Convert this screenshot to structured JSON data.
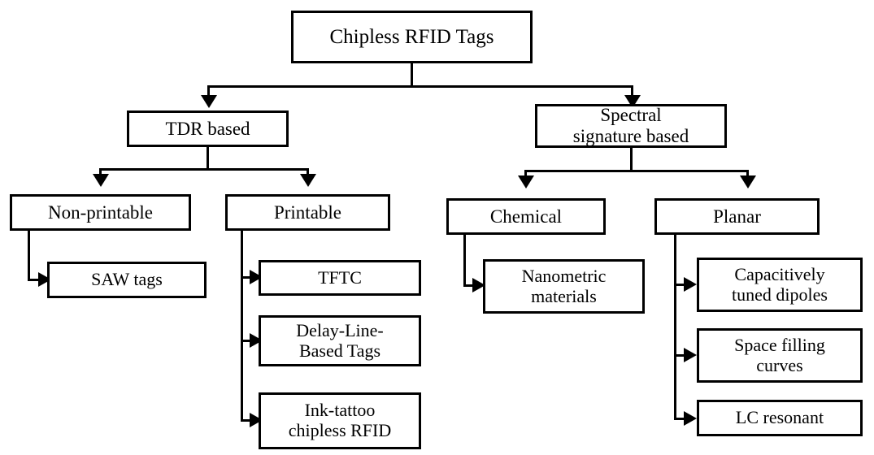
{
  "diagram": {
    "title": "Chipless RFID Tags",
    "type": "hierarchy-tree",
    "background_color": "#ffffff",
    "line_color": "#000000",
    "text_color": "#000000",
    "nodes": {
      "root": {
        "label": "Chipless RFID Tags"
      },
      "tdr": {
        "label": "TDR based"
      },
      "spectral_line1": {
        "label": "Spectral"
      },
      "spectral_line2": {
        "label": "signature based"
      },
      "non_printable": {
        "label": "Non-printable"
      },
      "printable": {
        "label": "Printable"
      },
      "chemical": {
        "label": "Chemical"
      },
      "planar": {
        "label": "Planar"
      },
      "saw_tags": {
        "label": "SAW tags"
      },
      "tftc": {
        "label": "TFTC"
      },
      "delay_line_l1": {
        "label": "Delay-Line-"
      },
      "delay_line_l2": {
        "label": "Based Tags"
      },
      "ink_tattoo_l1": {
        "label": "Ink-tattoo"
      },
      "ink_tattoo_l2": {
        "label": "chipless RFID"
      },
      "nanometric_l1": {
        "label": "Nanometric"
      },
      "nanometric_l2": {
        "label": "materials"
      },
      "capacitively_l1": {
        "label": "Capacitively"
      },
      "capacitively_l2": {
        "label": "tuned dipoles"
      },
      "space_filling_l1": {
        "label": "Space filling"
      },
      "space_filling_l2": {
        "label": "curves"
      },
      "lc_resonant": {
        "label": "LC resonant"
      }
    }
  }
}
